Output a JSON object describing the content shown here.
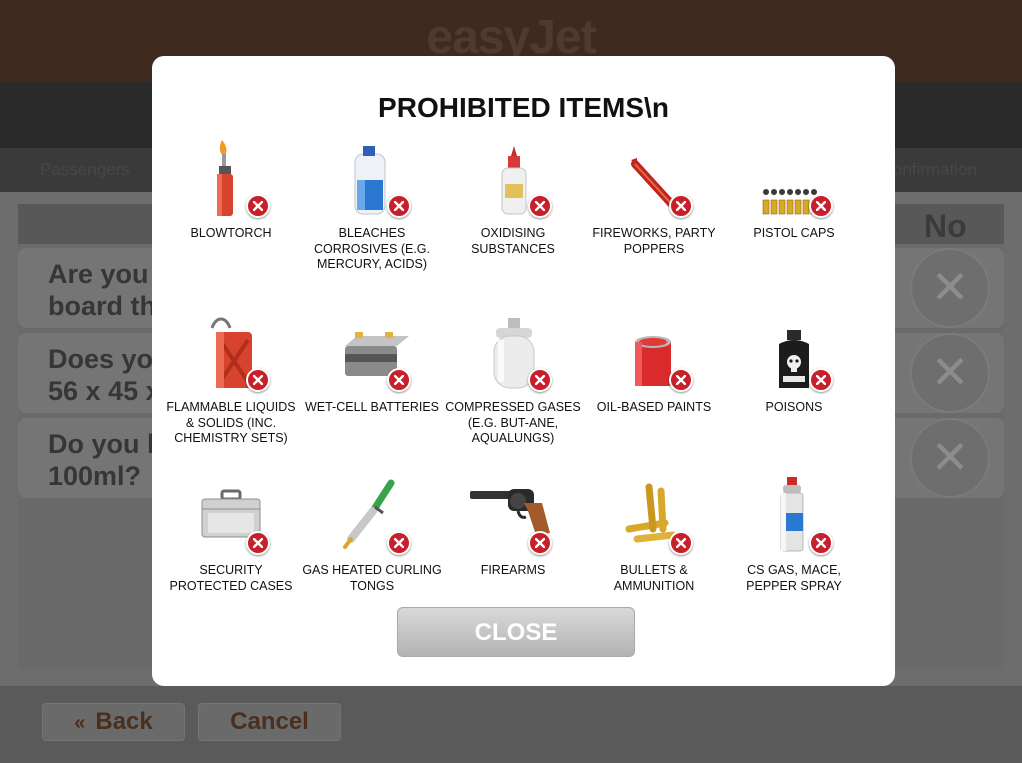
{
  "background": {
    "logo": "easyJet",
    "subnav_left": "Passengers",
    "subnav_right": "Confirmation",
    "table_header_no": "No",
    "questions": [
      {
        "line1": "Are you",
        "line2": "board th"
      },
      {
        "line1": "Does yo",
        "line2": "56 x 45 x"
      },
      {
        "line1": "Do you h",
        "line2": "100ml?"
      }
    ],
    "back_label": "Back",
    "back_glyph": "«",
    "cancel_label": "Cancel"
  },
  "modal": {
    "title": "PROHIBITED ITEMS\\n",
    "items": [
      {
        "label": "BLOWTORCH",
        "icon": "blowtorch-icon"
      },
      {
        "label": "BLEACHES CORROSIVES (E.G. MERCURY, ACIDS)",
        "icon": "bleach-icon"
      },
      {
        "label": "OXIDISING SUBSTANCES",
        "icon": "glue-bottle-icon"
      },
      {
        "label": "FIREWORKS, PARTY POPPERS",
        "icon": "firework-icon"
      },
      {
        "label": "PISTOL CAPS",
        "icon": "pistol-caps-icon"
      },
      {
        "label": "FLAMMABLE LIQUIDS & SOLIDS (INC. CHEMISTRY SETS)",
        "icon": "jerrycan-icon"
      },
      {
        "label": "WET-CELL BATTERIES",
        "icon": "battery-icon"
      },
      {
        "label": "COMPRESSED GASES (E.G. BUT-ANE, AQUALUNGS)",
        "icon": "gas-cylinder-icon"
      },
      {
        "label": "OIL-BASED PAINTS",
        "icon": "paint-can-icon"
      },
      {
        "label": "POISONS",
        "icon": "poison-bottle-icon"
      },
      {
        "label": "SECURITY PROTECTED CASES",
        "icon": "security-case-icon"
      },
      {
        "label": "GAS HEATED CURLING TONGS",
        "icon": "curling-tongs-icon"
      },
      {
        "label": "FIREARMS",
        "icon": "revolver-icon"
      },
      {
        "label": "BULLETS & AMMUNITION",
        "icon": "bullets-icon"
      },
      {
        "label": "CS GAS, MACE, PEPPER SPRAY",
        "icon": "spray-can-icon"
      }
    ],
    "close_label": "CLOSE"
  },
  "colors": {
    "brand_brown": "#3e2a1f",
    "badge_red": "#c8202a",
    "overlay_grey": "#6d6d6d"
  }
}
